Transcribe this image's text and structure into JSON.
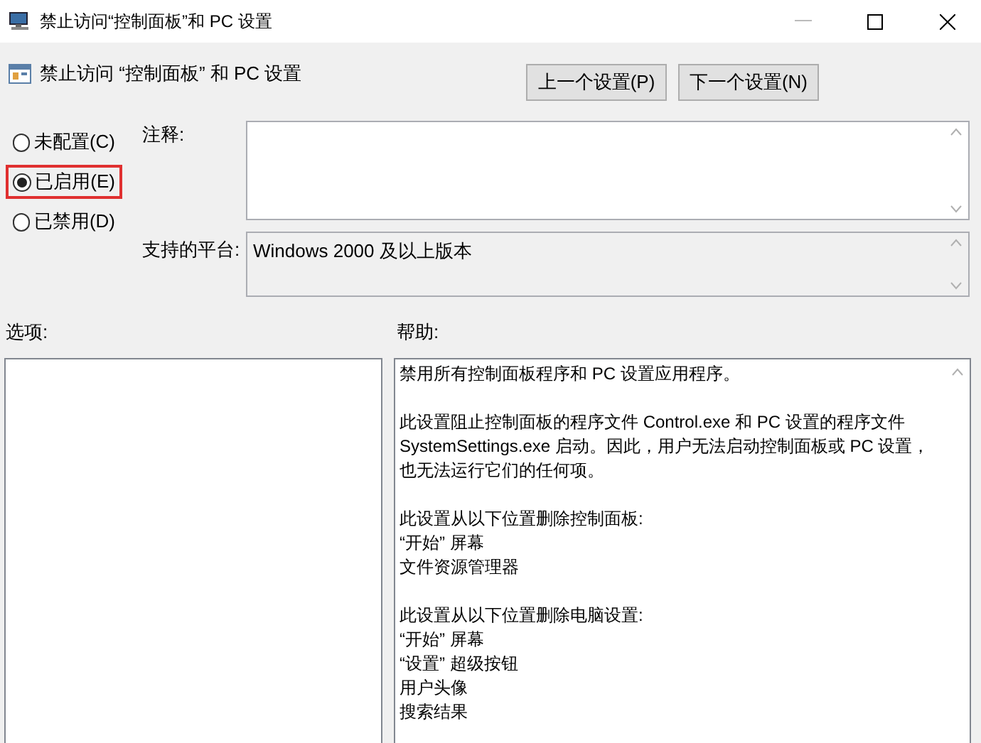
{
  "window": {
    "title": "禁止访问“控制面板”和 PC 设置"
  },
  "header": {
    "title": "禁止访问 “控制面板” 和 PC 设置"
  },
  "buttons": [
    "上一个设置(P)",
    "下一个设置(N)"
  ],
  "options": [
    {
      "label": "未配置(C)",
      "selected": false,
      "highlighted": false
    },
    {
      "label": "已启用(E)",
      "selected": true,
      "highlighted": true
    },
    {
      "label": "已禁用(D)",
      "selected": false,
      "highlighted": false
    }
  ],
  "comment": {
    "label": "注释:"
  },
  "platform": {
    "label": "支持的平台:",
    "value": "Windows 2000 及以上版本"
  },
  "options_panel": {
    "label": "选项:"
  },
  "help": {
    "label": "帮助:",
    "paragraphs": [
      [
        "禁用所有控制面板程序和 PC 设置应用程序。"
      ],
      [
        "此设置阻止控制面板的程序文件 Control.exe 和 PC 设置的程序文件",
        "SystemSettings.exe 启动。因此，用户无法启动控制面板或 PC 设置，",
        "也无法运行它们的任何项。"
      ],
      [
        "此设置从以下位置删除控制面板:",
        "“开始” 屏幕",
        "文件资源管理器"
      ],
      [
        "此设置从以下位置删除电脑设置:",
        "“开始” 屏幕",
        "“设置” 超级按钮",
        "用户头像",
        "搜索结果"
      ]
    ]
  }
}
